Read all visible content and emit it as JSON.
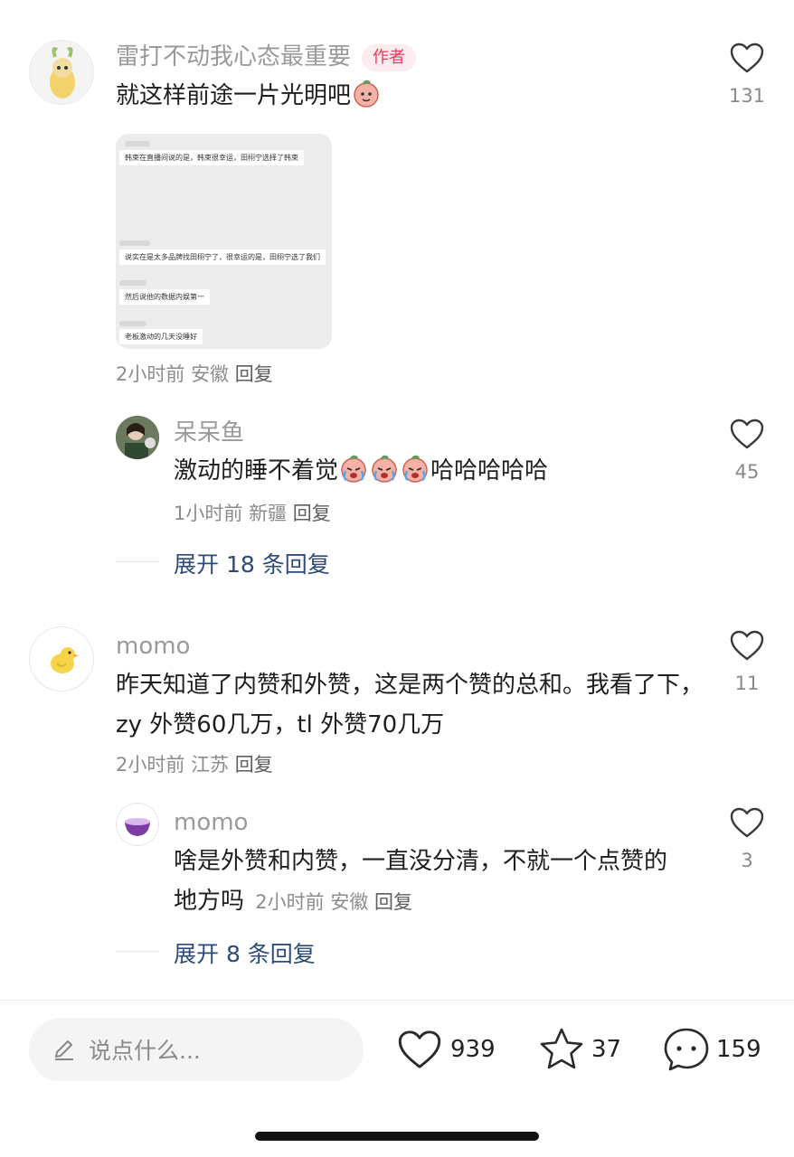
{
  "comments": [
    {
      "name": "雷打不动我心态最重要",
      "badge": "作者",
      "text": "就这样前途一片光明吧",
      "likes": "131",
      "time": "2小时前",
      "location": "安徽",
      "reply_label": "回复",
      "attachment_lines": [
        "韩束在直播间说的是，韩束很幸运，田栩宁选择了韩束",
        "说实在是太多品牌找田栩宁了，很幸运的是，田栩宁选了我们",
        "然后说他的数据内娱第一",
        "老板激动的几天没睡好"
      ],
      "replies": [
        {
          "name": "呆呆鱼",
          "text_suffix": "哈哈哈哈哈",
          "text_prefix": "激动的睡不着觉",
          "likes": "45",
          "time": "1小时前",
          "location": "新疆",
          "reply_label": "回复"
        }
      ],
      "expand_label": "展开 18 条回复"
    },
    {
      "name": "momo",
      "text": "昨天知道了内赞和外赞，这是两个赞的总和。我看了下，zy 外赞60几万，tl 外赞70几万",
      "likes": "11",
      "time": "2小时前",
      "location": "江苏",
      "reply_label": "回复",
      "replies": [
        {
          "name": "momo",
          "text": "啥是外赞和内赞，一直没分清，不就一个点赞的地方吗",
          "likes": "3",
          "time": "2小时前",
          "location": "安徽",
          "reply_label": "回复"
        }
      ],
      "expand_label": "展开 8 条回复"
    }
  ],
  "bottom_bar": {
    "input_placeholder": "说点什么...",
    "like_count": "939",
    "fav_count": "37",
    "comment_count": "159"
  },
  "colors": {
    "accent_badge": "#e83a5a",
    "expand_link": "#2d4b7a",
    "muted": "#9a9a9a"
  },
  "icons": [
    "heart-icon",
    "star-icon",
    "chat-bubble-icon",
    "pencil-icon",
    "peach-emoji-icon",
    "peach-crying-emoji-icon"
  ]
}
